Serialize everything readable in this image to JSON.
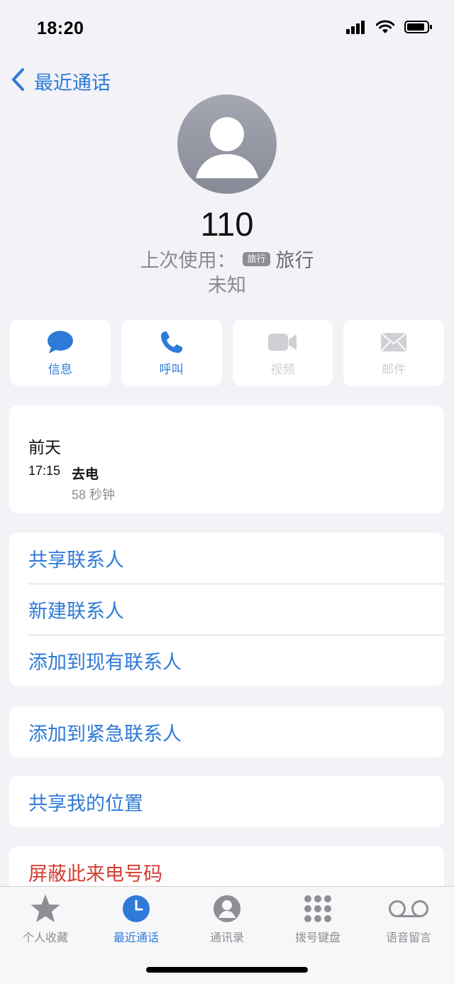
{
  "status_bar": {
    "time": "18:20",
    "icons": [
      "signal-icon",
      "wifi-icon",
      "battery-icon"
    ]
  },
  "nav": {
    "back_label": "最近通话",
    "back_icon": "chevron-left-icon"
  },
  "contact": {
    "avatar_icon": "person-silhouette-icon",
    "number": "110",
    "last_used_label": "上次使用：",
    "last_used_badge": "旅行",
    "last_used_value": "旅行",
    "carrier": "未知"
  },
  "actions": [
    {
      "label": "信息",
      "icon": "message-bubble-icon",
      "enabled": true
    },
    {
      "label": "呼叫",
      "icon": "phone-icon",
      "enabled": true
    },
    {
      "label": "视频",
      "icon": "video-camera-icon",
      "enabled": false
    },
    {
      "label": "邮件",
      "icon": "envelope-icon",
      "enabled": false
    }
  ],
  "call_history": {
    "date": "前天",
    "entries": [
      {
        "time": "17:15",
        "type": "去电",
        "duration": "58 秒钟"
      }
    ]
  },
  "options": {
    "group1": [
      "共享联系人",
      "新建联系人",
      "添加到现有联系人"
    ],
    "emergency": "添加到紧急联系人",
    "share_location": "共享我的位置",
    "block": "屏蔽此来电号码"
  },
  "tab_bar": {
    "tabs": [
      {
        "label": "个人收藏",
        "icon": "star-icon",
        "active": false
      },
      {
        "label": "最近通话",
        "icon": "clock-icon",
        "active": true
      },
      {
        "label": "通讯录",
        "icon": "person-circle-icon",
        "active": false
      },
      {
        "label": "拨号键盘",
        "icon": "keypad-icon",
        "active": false
      },
      {
        "label": "语音留言",
        "icon": "voicemail-icon",
        "active": false
      }
    ]
  },
  "colors": {
    "accent": "#2f7ad8",
    "destructive": "#d23d33",
    "background": "#f2f2f7",
    "disabled": "#cfcfd4"
  }
}
